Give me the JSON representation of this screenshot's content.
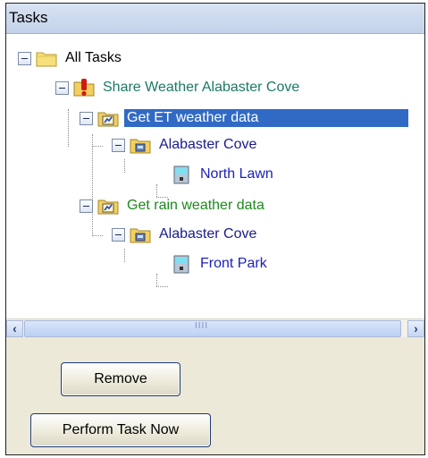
{
  "header": {
    "title": "Tasks"
  },
  "tree": [
    {
      "label": "All Tasks",
      "icon": "folder-icon",
      "color": "#000000"
    },
    {
      "label": "Share Weather Alabaster Cove",
      "icon": "alert-task-icon",
      "color": "#1b7a63"
    },
    {
      "label": "Get ET weather data",
      "icon": "weather-task-icon",
      "color": "#ffffff",
      "selected": true
    },
    {
      "label": "Alabaster Cove",
      "icon": "site-folder-icon",
      "color": "#1a1a8c"
    },
    {
      "label": "North Lawn",
      "icon": "controller-icon",
      "color": "#1c22b8"
    },
    {
      "label": "Get rain weather data",
      "icon": "weather-task-icon",
      "color": "#1d8a1d"
    },
    {
      "label": "Alabaster Cove",
      "icon": "site-folder-icon",
      "color": "#1a1a8c"
    },
    {
      "label": "Front Park",
      "icon": "controller-icon",
      "color": "#1c22b8"
    }
  ],
  "scrollbar": {
    "thumb_grip": "IIII"
  },
  "buttons": {
    "remove": "Remove",
    "perform": "Perform Task Now"
  }
}
